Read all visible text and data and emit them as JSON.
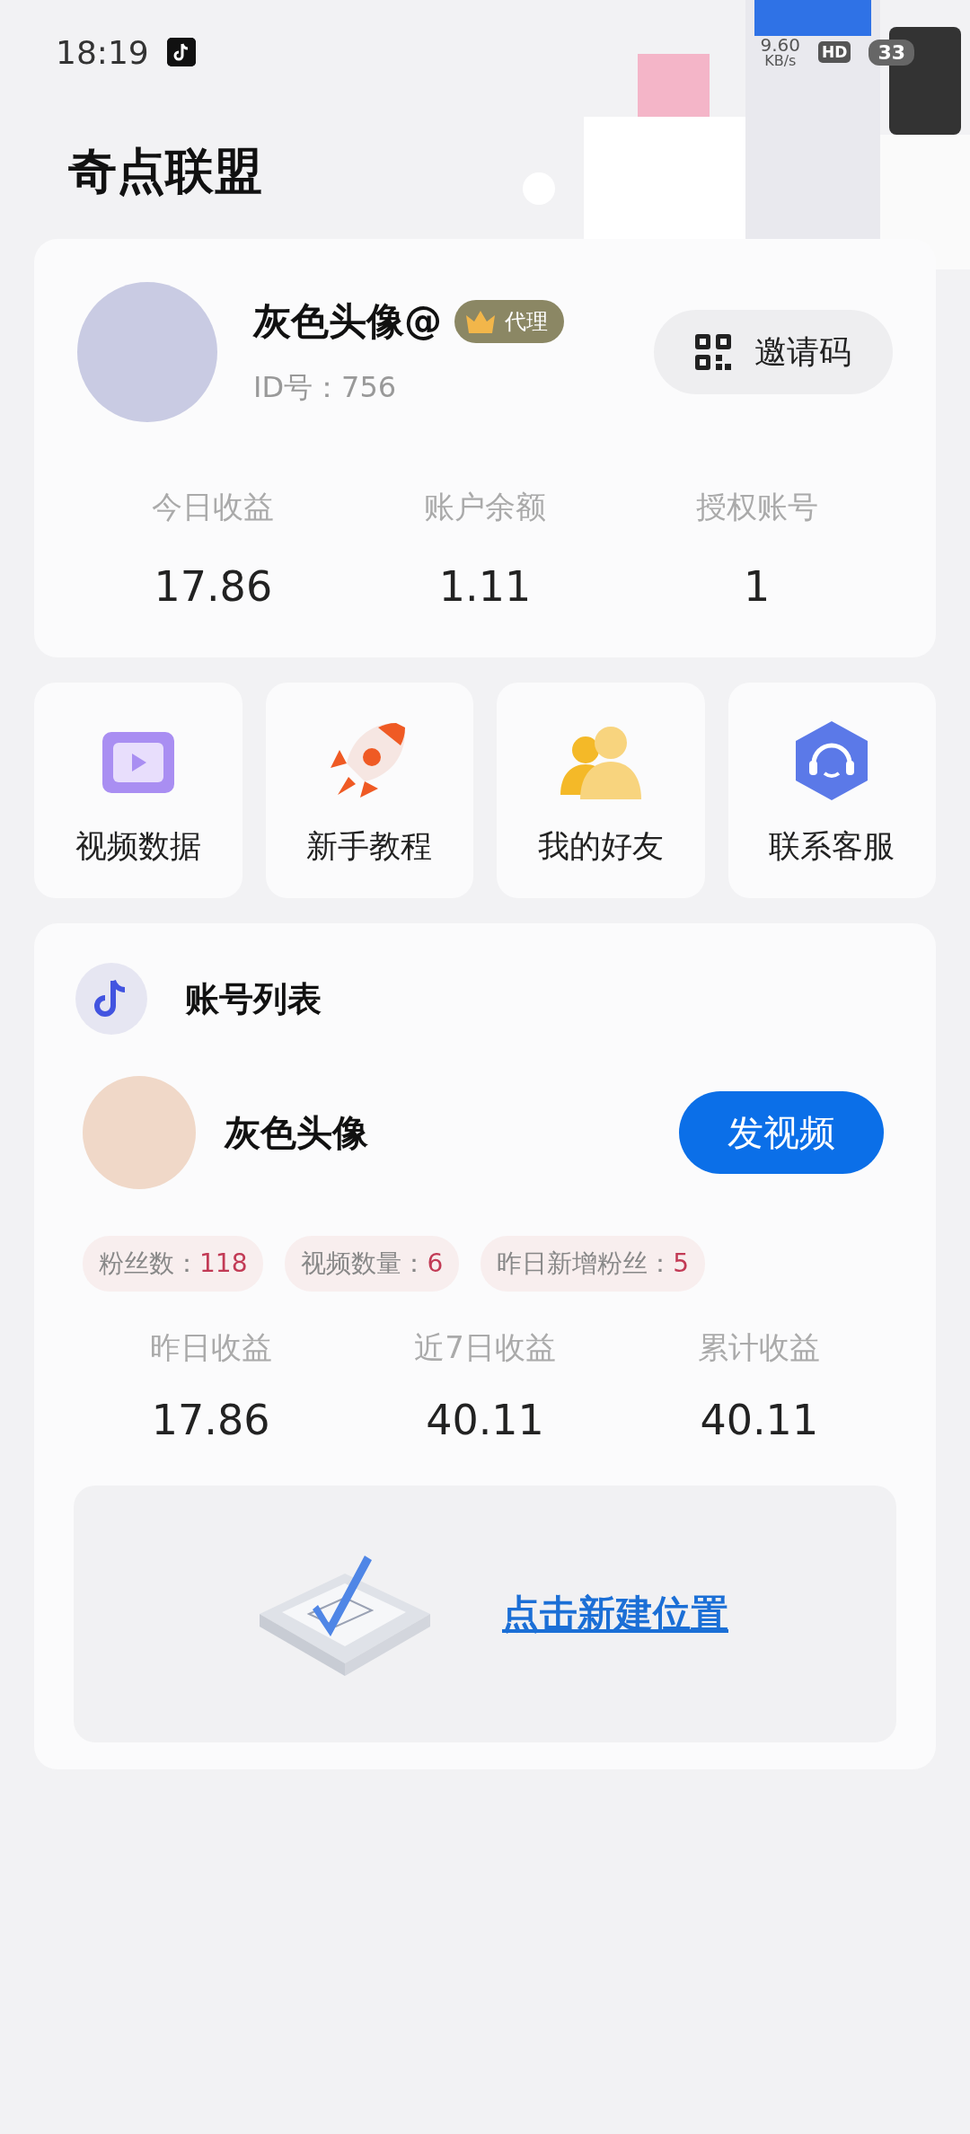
{
  "status_bar": {
    "time": "18:19",
    "speed_value": "9.60",
    "speed_unit": "KB/s",
    "hd": "HD",
    "battery": "33"
  },
  "page_title": "奇点联盟",
  "profile": {
    "name": "灰色头像@",
    "badge": "代理",
    "id_text": "ID号：756",
    "invite_button": "邀请码",
    "stats": [
      {
        "label": "今日收益",
        "value": "17.86"
      },
      {
        "label": "账户余额",
        "value": "1.11"
      },
      {
        "label": "授权账号",
        "value": "1"
      }
    ]
  },
  "shortcuts": [
    {
      "kind": "video",
      "label": "视频数据"
    },
    {
      "kind": "rocket",
      "label": "新手教程"
    },
    {
      "kind": "friends",
      "label": "我的好友"
    },
    {
      "kind": "service",
      "label": "联系客服"
    }
  ],
  "account_list": {
    "title": "账号列表",
    "account": {
      "name": "灰色头像",
      "button": "发视频"
    },
    "chips": [
      {
        "label": "粉丝数：",
        "value": "118"
      },
      {
        "label": "视频数量：",
        "value": "6"
      },
      {
        "label": "昨日新增粉丝：",
        "value": "5"
      }
    ],
    "stats": [
      {
        "label": "昨日收益",
        "value": "17.86"
      },
      {
        "label": "近7日收益",
        "value": "40.11"
      },
      {
        "label": "累计收益",
        "value": "40.11"
      }
    ],
    "create_link": "点击新建位置"
  }
}
